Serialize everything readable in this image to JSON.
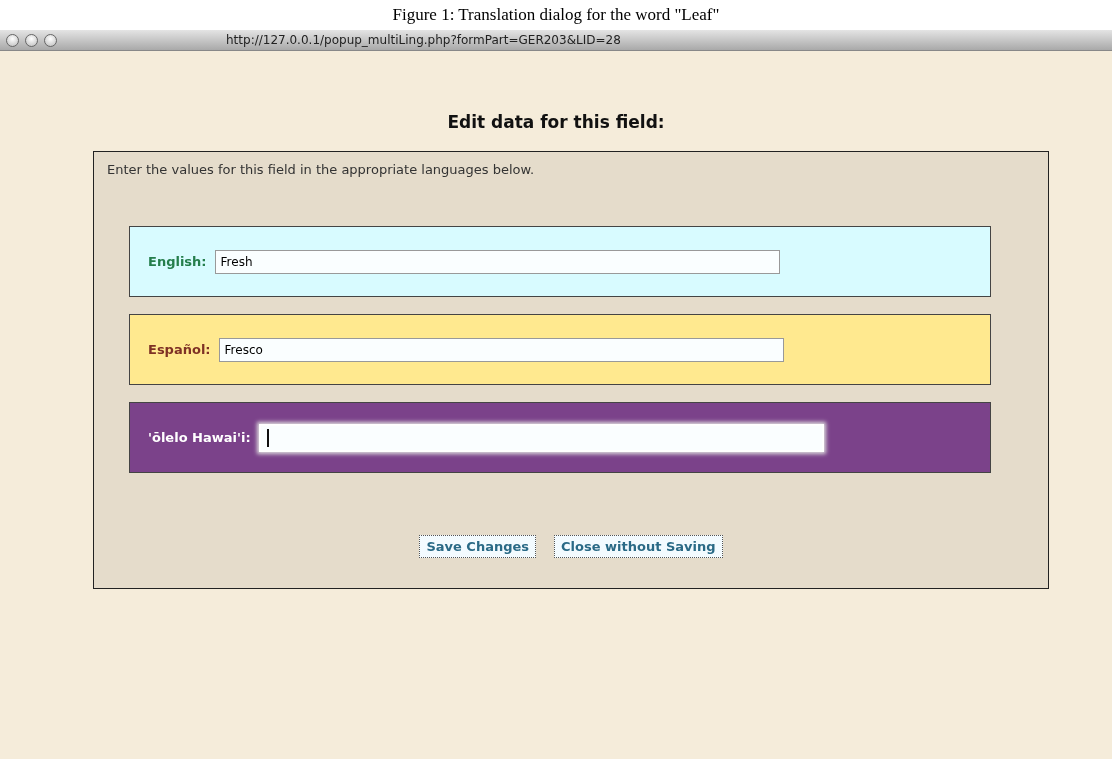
{
  "caption": "Figure 1: Translation dialog for the word \"Leaf\"",
  "window": {
    "url": "http://127.0.0.1/popup_multiLing.php?formPart=GER203&LID=28"
  },
  "heading": "Edit data for this field:",
  "instructions": "Enter the values for this field in the appropriate languages below.",
  "languages": [
    {
      "label": "English:",
      "value": "Fresh",
      "color": "#d8fbff",
      "focused": false
    },
    {
      "label": "Español:",
      "value": "Fresco",
      "color": "#ffe98f",
      "focused": false
    },
    {
      "label": "'ōlelo Hawai'i:",
      "color": "#7b428a",
      "focused": true
    }
  ],
  "buttons": [
    "Save Changes",
    "Close without Saving"
  ]
}
